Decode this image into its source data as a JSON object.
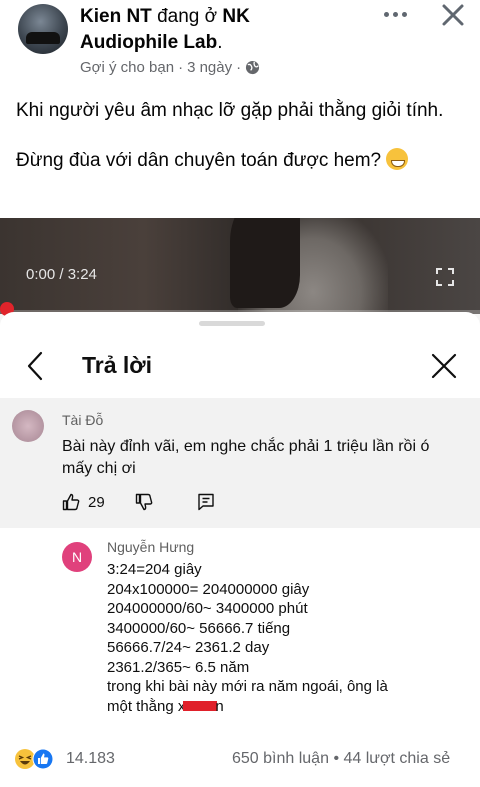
{
  "post": {
    "author_name": "Kien NT",
    "author_connector": "đang ở",
    "location_line1": "NK",
    "location_line2": "Audiophile Lab",
    "location_dot": ".",
    "suggested": "Gợi ý cho bạn",
    "time_ago": "3 ngày",
    "separator": "·",
    "text_line1": "Khi người yêu âm nhạc lỡ gặp phải thằng giỏi tính.",
    "text_line2": "Đừng đùa với dân chuyên toán được hem?",
    "emoji_icon": "grinning-sweat-emoji"
  },
  "video": {
    "time": "0:00 / 3:24",
    "progress_fraction": 0.0
  },
  "reply_sheet": {
    "title": "Trả lời",
    "parent_comment": {
      "author": "Tài Đỗ",
      "text": "Bài này đỉnh vãi, em nghe chắc phải 1 triệu lần rồi ó mấy chị ơi",
      "likes": "29"
    },
    "reply": {
      "avatar_letter": "N",
      "avatar_color": "#e0417c",
      "author": "Nguyễn Hưng",
      "lines": [
        "3:24=204 giây",
        "204x100000= 204000000 giây",
        "204000000/60~ 3400000 phút",
        "3400000/60~ 56666.7 tiếng",
        "56666.7/24~ 2361.2 day",
        "2361.2/365~ 6.5 năm",
        "trong khi bài này mới ra năm ngoái, ông là"
      ],
      "last_line_start": "một thằng x",
      "last_line_end": "n"
    }
  },
  "footer": {
    "reaction_count": "14.183",
    "comments": "650 bình luận",
    "dot": "•",
    "shares": "44 lượt chia sẻ"
  }
}
